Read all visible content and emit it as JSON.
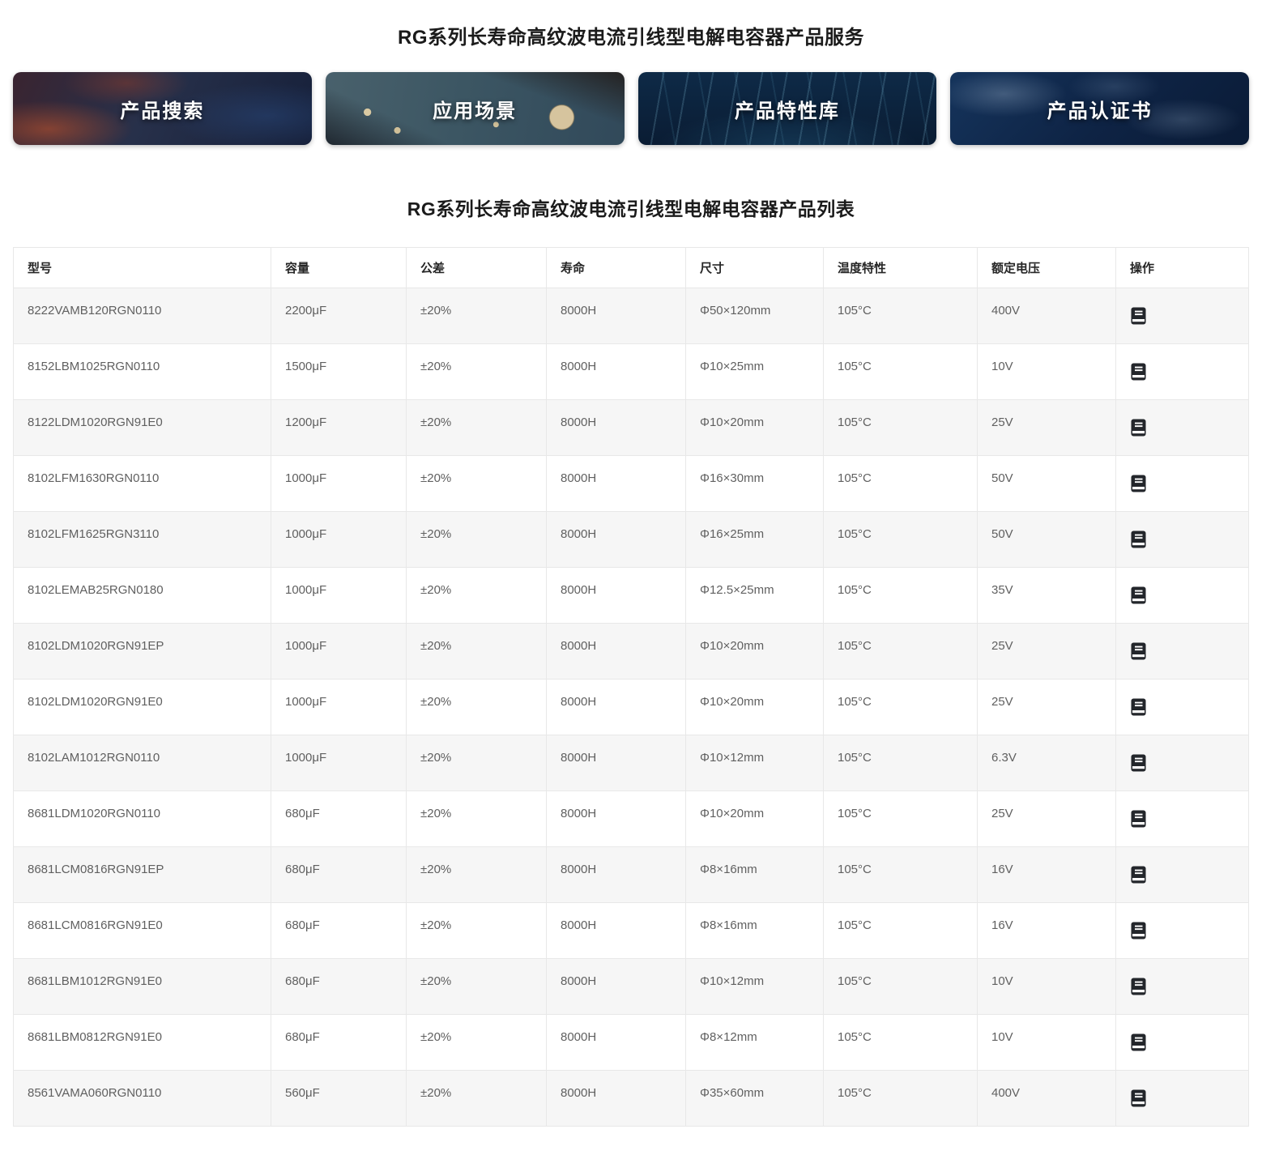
{
  "page": {
    "service_title": "RG系列长寿命高纹波电流引线型电解电容器产品服务",
    "list_title": "RG系列长寿命高纹波电流引线型电解电容器产品列表"
  },
  "nav": {
    "items": [
      {
        "label": "产品搜索",
        "background": "circuit-board-red-blue-photo"
      },
      {
        "label": "应用场景",
        "background": "circuit-board-teal-photo"
      },
      {
        "label": "产品特性库",
        "background": "light-streaks-dark-blue-photo"
      },
      {
        "label": "产品认证书",
        "background": "world-map-dark-blue-photo"
      }
    ]
  },
  "table": {
    "columns": [
      "型号",
      "容量",
      "公差",
      "寿命",
      "尺寸",
      "温度特性",
      "额定电压",
      "操作"
    ],
    "action_icon": "book-icon",
    "rows": [
      [
        "8222VAMB120RGN0110",
        "2200μF",
        "±20%",
        "8000H",
        "Φ50×120mm",
        "105°C",
        "400V"
      ],
      [
        "8152LBM1025RGN0110",
        "1500μF",
        "±20%",
        "8000H",
        "Φ10×25mm",
        "105°C",
        "10V"
      ],
      [
        "8122LDM1020RGN91E0",
        "1200μF",
        "±20%",
        "8000H",
        "Φ10×20mm",
        "105°C",
        "25V"
      ],
      [
        "8102LFM1630RGN0110",
        "1000μF",
        "±20%",
        "8000H",
        "Φ16×30mm",
        "105°C",
        "50V"
      ],
      [
        "8102LFM1625RGN3110",
        "1000μF",
        "±20%",
        "8000H",
        "Φ16×25mm",
        "105°C",
        "50V"
      ],
      [
        "8102LEMAB25RGN0180",
        "1000μF",
        "±20%",
        "8000H",
        "Φ12.5×25mm",
        "105°C",
        "35V"
      ],
      [
        "8102LDM1020RGN91EP",
        "1000μF",
        "±20%",
        "8000H",
        "Φ10×20mm",
        "105°C",
        "25V"
      ],
      [
        "8102LDM1020RGN91E0",
        "1000μF",
        "±20%",
        "8000H",
        "Φ10×20mm",
        "105°C",
        "25V"
      ],
      [
        "8102LAM1012RGN0110",
        "1000μF",
        "±20%",
        "8000H",
        "Φ10×12mm",
        "105°C",
        "6.3V"
      ],
      [
        "8681LDM1020RGN0110",
        "680μF",
        "±20%",
        "8000H",
        "Φ10×20mm",
        "105°C",
        "25V"
      ],
      [
        "8681LCM0816RGN91EP",
        "680μF",
        "±20%",
        "8000H",
        "Φ8×16mm",
        "105°C",
        "16V"
      ],
      [
        "8681LCM0816RGN91E0",
        "680μF",
        "±20%",
        "8000H",
        "Φ8×16mm",
        "105°C",
        "16V"
      ],
      [
        "8681LBM1012RGN91E0",
        "680μF",
        "±20%",
        "8000H",
        "Φ10×12mm",
        "105°C",
        "10V"
      ],
      [
        "8681LBM0812RGN91E0",
        "680μF",
        "±20%",
        "8000H",
        "Φ8×12mm",
        "105°C",
        "10V"
      ],
      [
        "8561VAMA060RGN0110",
        "560μF",
        "±20%",
        "8000H",
        "Φ35×60mm",
        "105°C",
        "400V"
      ]
    ]
  },
  "colors": {
    "stripe_row": "#f6f6f6",
    "table_border": "#e8e8e8",
    "header_text": "#262626",
    "body_text": "#606060",
    "nav_text": "#ffffff",
    "icon_fill": "#23262b"
  }
}
